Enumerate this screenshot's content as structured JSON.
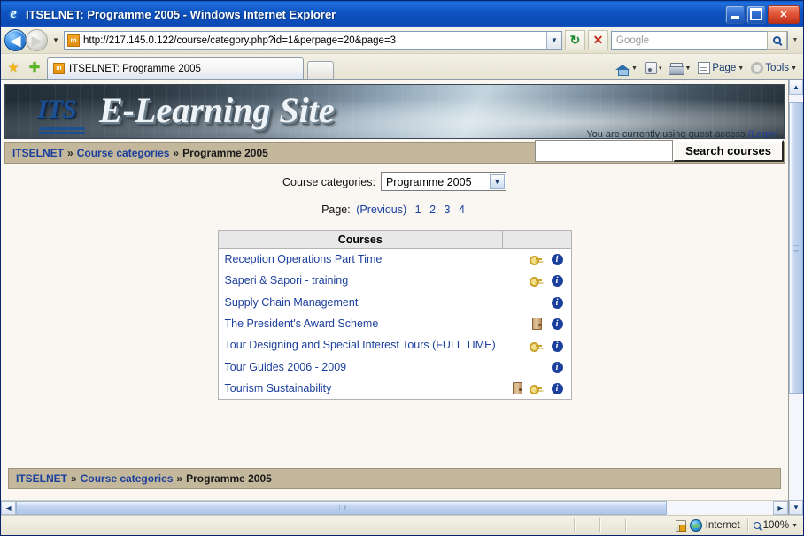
{
  "window": {
    "title": "ITSELNET: Programme 2005 - Windows Internet Explorer",
    "minimize_label": "",
    "maximize_label": "",
    "close_label": "✕"
  },
  "browser": {
    "back_label": "◀",
    "forward_label": "▶",
    "nav_dropdown_label": "▼",
    "favicon_label": "m",
    "url": "http://217.145.0.122/course/category.php?id=1&perpage=20&page=3",
    "url_dropdown_label": "▼",
    "refresh_label": "↻",
    "stop_label": "✕",
    "search_placeholder": "Google",
    "search_value": "",
    "search_dropdown_label": "▼",
    "tab_title": "ITSELNET: Programme 2005",
    "tab_favicon_label": "m",
    "favorites_star_label": "★",
    "favorites_add_label": "✚",
    "toolbar_items": [
      {
        "label": "",
        "name": "home-icon",
        "caret": "▼"
      },
      {
        "label": "",
        "name": "rss-icon",
        "caret": "▾"
      },
      {
        "label": "",
        "name": "print-icon",
        "caret": "▼"
      },
      {
        "label": "Page",
        "name": "page-menu",
        "caret": "▼"
      },
      {
        "label": "Tools",
        "name": "tools-menu",
        "caret": "▼"
      }
    ]
  },
  "site": {
    "logo_text": "ITS",
    "banner_title": "E-Learning Site",
    "guest_notice": "You are currently using guest access",
    "guest_login_label": "(Login)"
  },
  "breadcrumb": {
    "root": "ITSELNET",
    "sep": "»",
    "middle": "Course categories",
    "current": "Programme 2005"
  },
  "course_search": {
    "input_value": "",
    "button_label": "Search courses"
  },
  "category_selector": {
    "label": "Course categories:",
    "selected": "Programme 2005",
    "arrow": "▼"
  },
  "pagination": {
    "label": "Page:",
    "previous_label": "(Previous)",
    "pages": [
      "1",
      "2",
      "3",
      "4"
    ],
    "current": "3"
  },
  "courses_table": {
    "header": "Courses",
    "header_blank": "",
    "rows": [
      {
        "name": "Reception Operations Part Time",
        "has_guest": false,
        "has_key": true,
        "has_info": true
      },
      {
        "name": "Saperi & Sapori - training",
        "has_guest": false,
        "has_key": true,
        "has_info": true
      },
      {
        "name": "Supply Chain Management",
        "has_guest": false,
        "has_key": false,
        "has_info": true
      },
      {
        "name": "The President's Award Scheme",
        "has_guest": true,
        "has_key": false,
        "has_info": true
      },
      {
        "name": "Tour Designing and Special Interest Tours (FULL TIME)",
        "has_guest": false,
        "has_key": true,
        "has_info": true
      },
      {
        "name": "Tour Guides 2006 - 2009",
        "has_guest": false,
        "has_key": false,
        "has_info": true
      },
      {
        "name": "Tourism Sustainability",
        "has_guest": true,
        "has_key": true,
        "has_info": true
      }
    ],
    "info_glyph": "i"
  },
  "statusbar": {
    "zone_label": "Internet",
    "zoom_label": "100%",
    "zoom_caret": "▼"
  },
  "scrollbars": {
    "up_label": "▲",
    "down_label": "▼",
    "left_label": "◀",
    "right_label": "▶"
  },
  "colors": {
    "titlebar_blue": "#0b4ab4",
    "breadcrumb_tan": "#c4b89c",
    "link_blue": "#1b3f9c",
    "page_bg": "#faf7f3",
    "table_header": "#e8e8e8"
  }
}
